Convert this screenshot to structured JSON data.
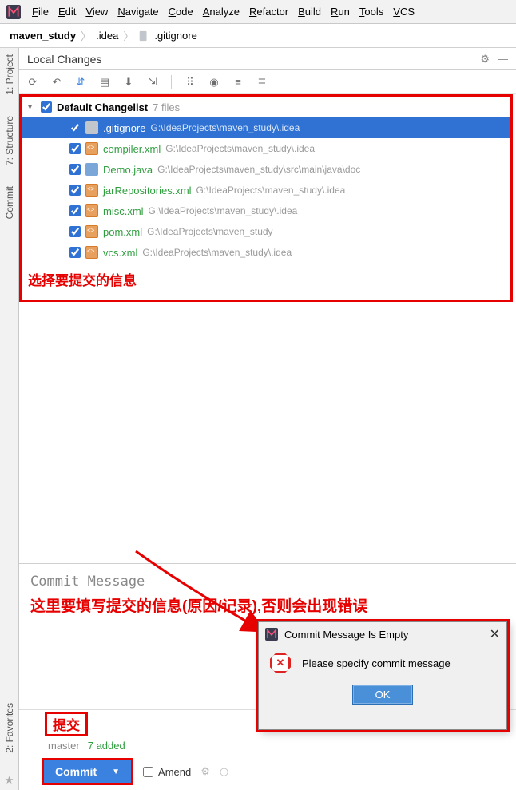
{
  "menu": [
    "File",
    "Edit",
    "View",
    "Navigate",
    "Code",
    "Analyze",
    "Refactor",
    "Build",
    "Run",
    "Tools",
    "VCS"
  ],
  "breadcrumb": {
    "root": "maven_study",
    "mid": ".idea",
    "leaf": ".gitignore"
  },
  "sidebar_tabs": {
    "project": "1: Project",
    "structure": "7: Structure",
    "commit": "Commit",
    "favorites": "2: Favorites"
  },
  "panel": {
    "title": "Local Changes"
  },
  "changelist": {
    "name": "Default Changelist",
    "count": "7 files",
    "items": [
      {
        "name": ".gitignore",
        "path": "G:\\IdeaProjects\\maven_study\\.idea",
        "green": false,
        "sel": true,
        "icon": "gray"
      },
      {
        "name": "compiler.xml",
        "path": "G:\\IdeaProjects\\maven_study\\.idea",
        "green": true,
        "sel": false,
        "icon": "orange"
      },
      {
        "name": "Demo.java",
        "path": "G:\\IdeaProjects\\maven_study\\src\\main\\java\\doc",
        "green": true,
        "sel": false,
        "icon": "blue"
      },
      {
        "name": "jarRepositories.xml",
        "path": "G:\\IdeaProjects\\maven_study\\.idea",
        "green": true,
        "sel": false,
        "icon": "orange"
      },
      {
        "name": "misc.xml",
        "path": "G:\\IdeaProjects\\maven_study\\.idea",
        "green": true,
        "sel": false,
        "icon": "orange"
      },
      {
        "name": "pom.xml",
        "path": "G:\\IdeaProjects\\maven_study",
        "green": true,
        "sel": false,
        "icon": "orange"
      },
      {
        "name": "vcs.xml",
        "path": "G:\\IdeaProjects\\maven_study\\.idea",
        "green": true,
        "sel": false,
        "icon": "orange"
      }
    ],
    "note": "选择要提交的信息"
  },
  "commit_msg": {
    "label": "Commit Message",
    "note": "这里要填写提交的信息(原因/记录),否则会出现错误"
  },
  "dialog": {
    "title": "Commit Message Is Empty",
    "body": "Please specify commit message",
    "ok": "OK"
  },
  "bottom": {
    "submit_note": "提交",
    "branch": "master",
    "added": "7 added",
    "commit": "Commit",
    "amend": "Amend"
  }
}
